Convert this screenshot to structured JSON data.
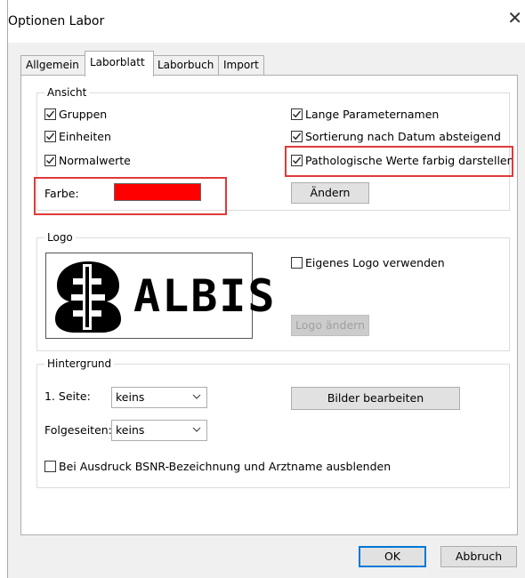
{
  "window": {
    "title": "Optionen Labor"
  },
  "tabs": [
    {
      "label": "Allgemein"
    },
    {
      "label": "Laborblatt"
    },
    {
      "label": "Laborbuch"
    },
    {
      "label": "Import"
    }
  ],
  "ansicht": {
    "legend": "Ansicht",
    "checkboxes": [
      {
        "label": "Gruppen",
        "checked": true
      },
      {
        "label": "Einheiten",
        "checked": true
      },
      {
        "label": "Normalwerte",
        "checked": true
      },
      {
        "label": "Lange Parameternamen",
        "checked": true
      },
      {
        "label": "Sortierung nach Datum absteigend",
        "checked": true
      },
      {
        "label": "Pathologische Werte farbig darstellen",
        "checked": true
      }
    ],
    "farbe_label": "Farbe:",
    "farbe_color": "#ff0000",
    "aendern_button": "Ändern"
  },
  "logo": {
    "legend": "Logo",
    "image_text": "ALBIS",
    "eigenes_logo_label": "Eigenes Logo verwenden",
    "eigenes_logo_checked": false,
    "logo_aendern_button": "Logo ändern"
  },
  "hintergrund": {
    "legend": "Hintergrund",
    "seite1_label": "1. Seite:",
    "seite1_value": "keins",
    "folgeseiten_label": "Folgeseiten:",
    "folgeseiten_value": "keins",
    "bilder_button": "Bilder bearbeiten",
    "ausblenden_label": "Bei Ausdruck BSNR-Bezeichnung und Arztname ausblenden",
    "ausblenden_checked": false
  },
  "footer": {
    "ok_button": "OK",
    "abbruch_button": "Abbruch"
  },
  "colors": {
    "highlight_red": "#e03a3a",
    "accent_blue": "#0078d7"
  }
}
